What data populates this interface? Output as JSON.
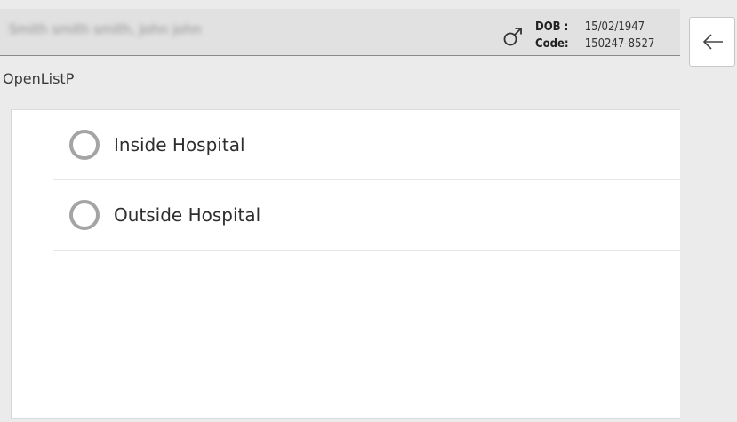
{
  "header": {
    "patient_name": "Smith smith smith, John john",
    "gender_icon": "male-symbol-icon",
    "dob_label": "DOB :",
    "dob_value": "15/02/1947",
    "code_label": "Code:",
    "code_value": "150247-8527"
  },
  "toolbar": {
    "back_icon": "arrow-left-icon"
  },
  "list": {
    "title": "OpenListP",
    "options": [
      {
        "label": "Inside Hospital",
        "selected": false
      },
      {
        "label": "Outside Hospital",
        "selected": false
      }
    ]
  },
  "colors": {
    "header_bg": "#e1e1e1",
    "page_bg": "#ebebeb",
    "panel_bg": "#ffffff",
    "radio_border": "#a4a4a4"
  }
}
